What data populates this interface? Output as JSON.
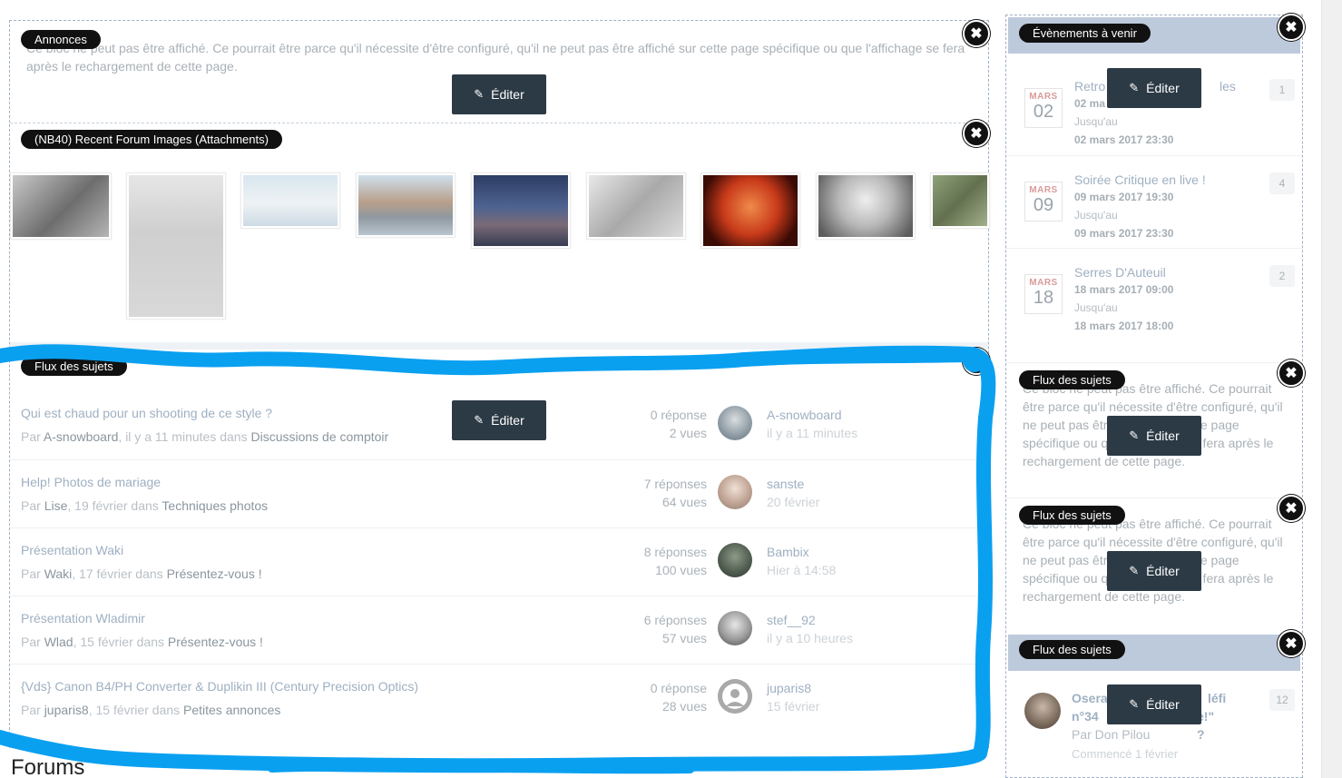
{
  "main": {
    "annonces": {
      "label": "Annonces",
      "notice": "Ce bloc ne peut pas être affiché. Ce pourrait être parce qu'il nécessite d'être configuré, qu'il ne peut pas être affiché sur cette page spécifique ou que l'affichage se fera après le rechargement de cette page.",
      "edit_label": "Éditer"
    },
    "images": {
      "label": "(NB40) Recent Forum Images (Attachments)"
    },
    "topics": {
      "label": "Flux des sujets",
      "edit_label": "Éditer",
      "rows": [
        {
          "title": "Qui est chaud pour un shooting de ce style ?",
          "by": "Par",
          "author": "A-snowboard",
          "date": ", il y a 11 minutes dans",
          "forum": "Discussions de comptoir",
          "replies": "0 réponse",
          "views": "2 vues",
          "last_user": "A-snowboard",
          "last_time": "il y a 11 minutes"
        },
        {
          "title": "Help! Photos de mariage",
          "by": "Par",
          "author": "Lise",
          "date": ", 19 février dans",
          "forum": "Techniques photos",
          "replies": "7 réponses",
          "views": "64 vues",
          "last_user": "sanste",
          "last_time": "20 février"
        },
        {
          "title": "Présentation Waki",
          "by": "Par",
          "author": "Waki",
          "date": ", 17 février dans",
          "forum": "Présentez-vous !",
          "replies": "8 réponses",
          "views": "100 vues",
          "last_user": "Bambix",
          "last_time": "Hier à 14:58"
        },
        {
          "title": "Présentation Wladimir",
          "by": "Par",
          "author": "Wlad",
          "date": ", 15 février dans",
          "forum": "Présentez-vous !",
          "replies": "6 réponses",
          "views": "57 vues",
          "last_user": "stef__92",
          "last_time": "il y a 10 heures"
        },
        {
          "title": "{Vds} Canon B4/PH Converter & Duplikin III (Century Precision Optics)",
          "by": "Par",
          "author": "juparis8",
          "date": ", 15 février dans",
          "forum": "Petites annonces",
          "replies": "0 réponse",
          "views": "28 vues",
          "last_user": "juparis8",
          "last_time": "15 février"
        }
      ]
    },
    "forums_heading": "Forums"
  },
  "sidebar": {
    "events": {
      "label": "Évènements à venir",
      "edit_label": "Éditer",
      "items": [
        {
          "title": "Retro",
          "title_tail": "les",
          "month": "MARS",
          "day": "02",
          "start": "02 ma",
          "until": "Jusqu'au",
          "end": "02 mars 2017 23:30",
          "count": "1"
        },
        {
          "title": "Soirée Critique en live !",
          "title_tail": "",
          "month": "MARS",
          "day": "09",
          "start": "09 mars 2017 19:30",
          "until": "Jusqu'au",
          "end": "09 mars 2017 23:30",
          "count": "4"
        },
        {
          "title": "Serres D'Auteuil",
          "title_tail": "",
          "month": "MARS",
          "day": "18",
          "start": "18 mars 2017 09:00",
          "until": "Jusqu'au",
          "end": "18 mars 2017 18:00",
          "count": "2"
        }
      ]
    },
    "flux1": {
      "label": "Flux des sujets",
      "edit_label": "Éditer",
      "notice": "Ce bloc ne peut pas être affiché. Ce pourrait être parce qu'il nécessite d'être configuré, qu'il ne peut pas être affiché sur cette page spécifique ou que l'affichage se fera après le rechargement de cette page."
    },
    "flux2": {
      "label": "Flux des sujets",
      "edit_label": "Éditer",
      "notice": "Ce bloc ne peut pas être affiché. Ce pourrait être parce qu'il nécessite d'être configuré, qu'il ne peut pas être affiché sur cette page spécifique ou que l'affichage se fera après le rechargement de cette page."
    },
    "flux3": {
      "label": "Flux des sujets",
      "edit_label": "Éditer",
      "topic_title_a": "Osera",
      "topic_title_b": "léfi",
      "topic_title_c": "n°34",
      "topic_title_d": "e!\" ?",
      "author_line": "Par Don Pilou",
      "started": "Commencé 1 février",
      "count": "12"
    }
  },
  "colors": {
    "label_bg": "#111111",
    "edit_bg": "#2c3a45",
    "header_bar": "#bdcadb",
    "highlight": "#0aa0f0"
  }
}
